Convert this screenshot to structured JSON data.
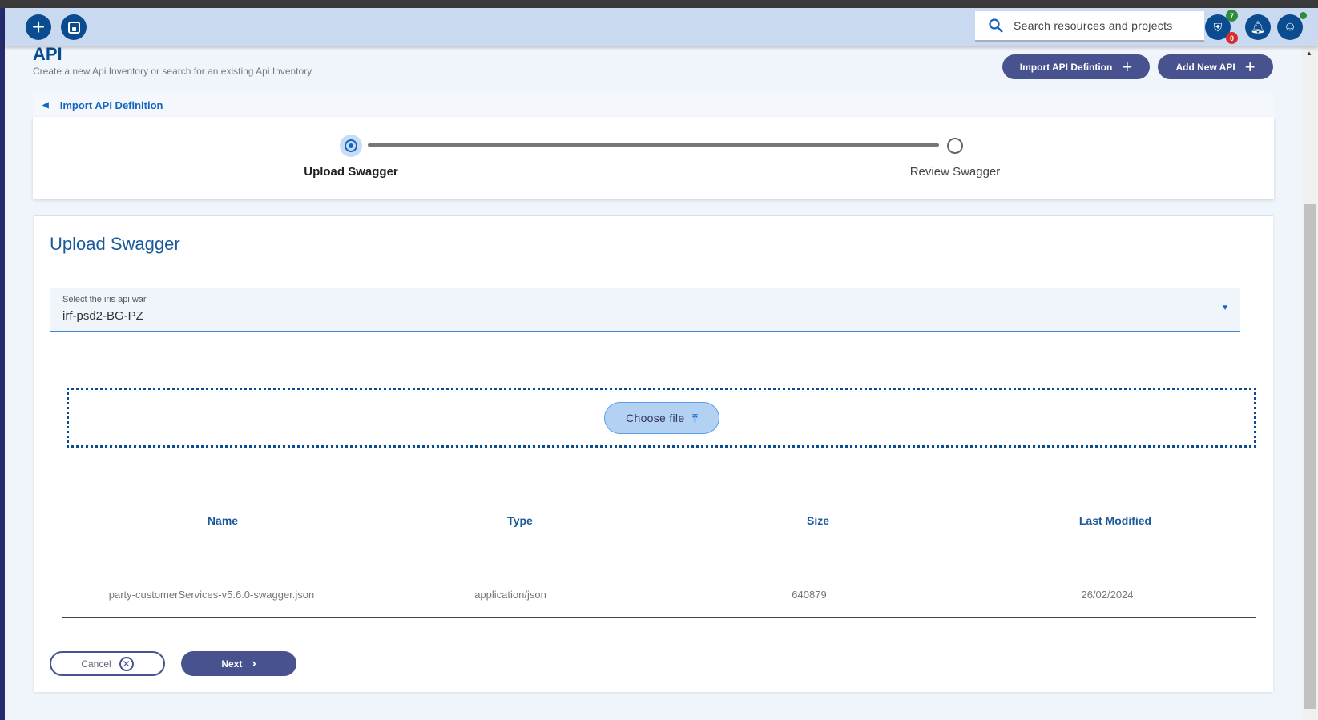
{
  "topbar": {
    "search_placeholder": "Search resources and projects",
    "shield_badge_top": "7",
    "shield_badge_bottom": "0"
  },
  "page": {
    "title": "API",
    "subtitle": "Create a new Api Inventory or search for an existing Api Inventory",
    "import_button": "Import API Defintion",
    "add_button": "Add New API"
  },
  "breadcrumb": {
    "label": "Import API Definition"
  },
  "stepper": {
    "steps": [
      {
        "label": "Upload Swagger",
        "active": true
      },
      {
        "label": "Review Swagger",
        "active": false
      }
    ]
  },
  "form": {
    "title": "Upload Swagger",
    "select_label": "Select the iris api war",
    "select_value": "irf-psd2-BG-PZ",
    "choose_file": "Choose file"
  },
  "table": {
    "headers": [
      "Name",
      "Type",
      "Size",
      "Last Modified"
    ],
    "rows": [
      [
        "party-customerServices-v5.6.0-swagger.json",
        "application/json",
        "640879",
        "26/02/2024"
      ]
    ]
  },
  "actions": {
    "cancel": "Cancel",
    "next": "Next"
  },
  "colors": {
    "primary": "#0a4c8f",
    "button": "#48528f",
    "accent": "#1565c0"
  }
}
